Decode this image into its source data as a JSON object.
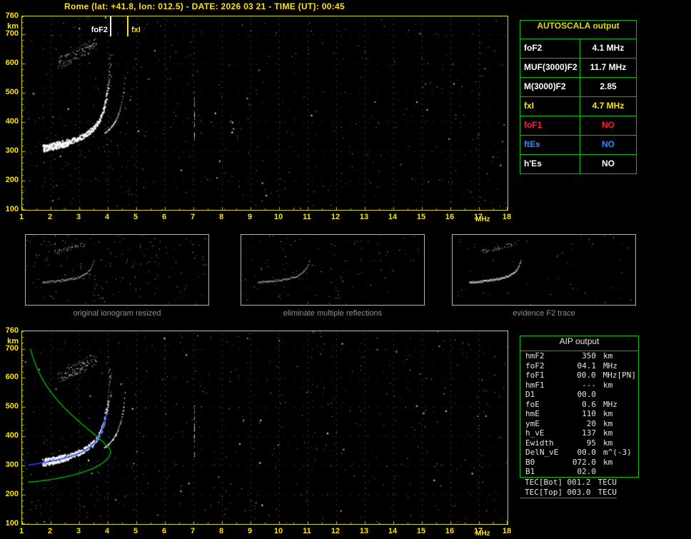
{
  "title": "Rome (lat: +41.8, lon: 012.5) - DATE: 2026 03 21 - TIME (UT): 00:45",
  "colors": {
    "background": "#000000",
    "axis_text": "#ffe400",
    "plot_border": "#d8d800",
    "panel_border": "#00c000",
    "trace_white": "#ffffff",
    "profile_green": "#00b400",
    "trace_blue": "#2840ff",
    "caption_gray": "#8f8f8f"
  },
  "ionogram_axes": {
    "x_ticks": [
      "1",
      "2",
      "3",
      "4",
      "5",
      "6",
      "7",
      "8",
      "9",
      "10",
      "11",
      "12",
      "13",
      "14",
      "15",
      "16",
      "17",
      "18"
    ],
    "x_unit": "MHz",
    "x_range_mhz": [
      1,
      18
    ],
    "y_ticks": [
      "760",
      "700",
      "600",
      "500",
      "400",
      "300",
      "200",
      "100"
    ],
    "y_unit": "km",
    "y_range_km": [
      100,
      760
    ]
  },
  "top_plot": {
    "markers": [
      {
        "label": "foF2",
        "freq_mhz": 4.1,
        "color": "#ffffff"
      },
      {
        "label": "fxI",
        "freq_mhz": 4.7,
        "color": "#ffe400"
      }
    ]
  },
  "autoscala_table": {
    "title": "AUTOSCALA output",
    "rows": [
      {
        "param": "foF2",
        "value": "4.1 MHz",
        "color": "#ffffff"
      },
      {
        "param": "MUF(3000)F2",
        "value": "11.7 MHz",
        "color": "#ffffff"
      },
      {
        "param": "M(3000)F2",
        "value": "2.85",
        "color": "#ffffff"
      },
      {
        "param": "fxI",
        "value": "4.7 MHz",
        "color": "#ffe400"
      },
      {
        "param": "foF1",
        "value": "NO",
        "color": "#ff2020"
      },
      {
        "param": "ftEs",
        "value": "NO",
        "color": "#2090ff"
      },
      {
        "param": "h'Es",
        "value": "NO",
        "color": "#ffffff"
      }
    ]
  },
  "panels": [
    {
      "caption": "original ionogram resized"
    },
    {
      "caption": "eliminate multiple reflections"
    },
    {
      "caption": "evidence F2 trace"
    }
  ],
  "aip_table": {
    "title": "AIP output",
    "rows": [
      {
        "param": "hmF2",
        "value": "350",
        "unit": "km",
        "extra": ""
      },
      {
        "param": "foF2",
        "value": "04.1",
        "unit": "MHz",
        "extra": ""
      },
      {
        "param": "foF1",
        "value": "00.0",
        "unit": "MHz",
        "extra": "[PN]"
      },
      {
        "param": "hmF1",
        "value": "---",
        "unit": "km",
        "extra": ""
      },
      {
        "param": "D1",
        "value": "00.0",
        "unit": "",
        "extra": ""
      },
      {
        "param": "foE",
        "value": "0.6",
        "unit": "MHz",
        "extra": ""
      },
      {
        "param": "hmE",
        "value": "110",
        "unit": "km",
        "extra": ""
      },
      {
        "param": "ymE",
        "value": "20",
        "unit": "km",
        "extra": ""
      },
      {
        "param": "h_vE",
        "value": "137",
        "unit": "km",
        "extra": ""
      },
      {
        "param": "Ewidth",
        "value": "95",
        "unit": "km",
        "extra": ""
      },
      {
        "param": "DelN_vE",
        "value": "00.0",
        "unit": "m^(-3)",
        "extra": ""
      },
      {
        "param": "B0",
        "value": "072.0",
        "unit": "km",
        "extra": ""
      },
      {
        "param": "B1",
        "value": "02.0",
        "unit": "",
        "extra": ""
      }
    ],
    "tec_rows": [
      {
        "param": "TEC[Bot]",
        "value": "001.2",
        "unit": "TECU"
      },
      {
        "param": "TEC[Top]",
        "value": "003.0",
        "unit": "TECU"
      }
    ]
  }
}
